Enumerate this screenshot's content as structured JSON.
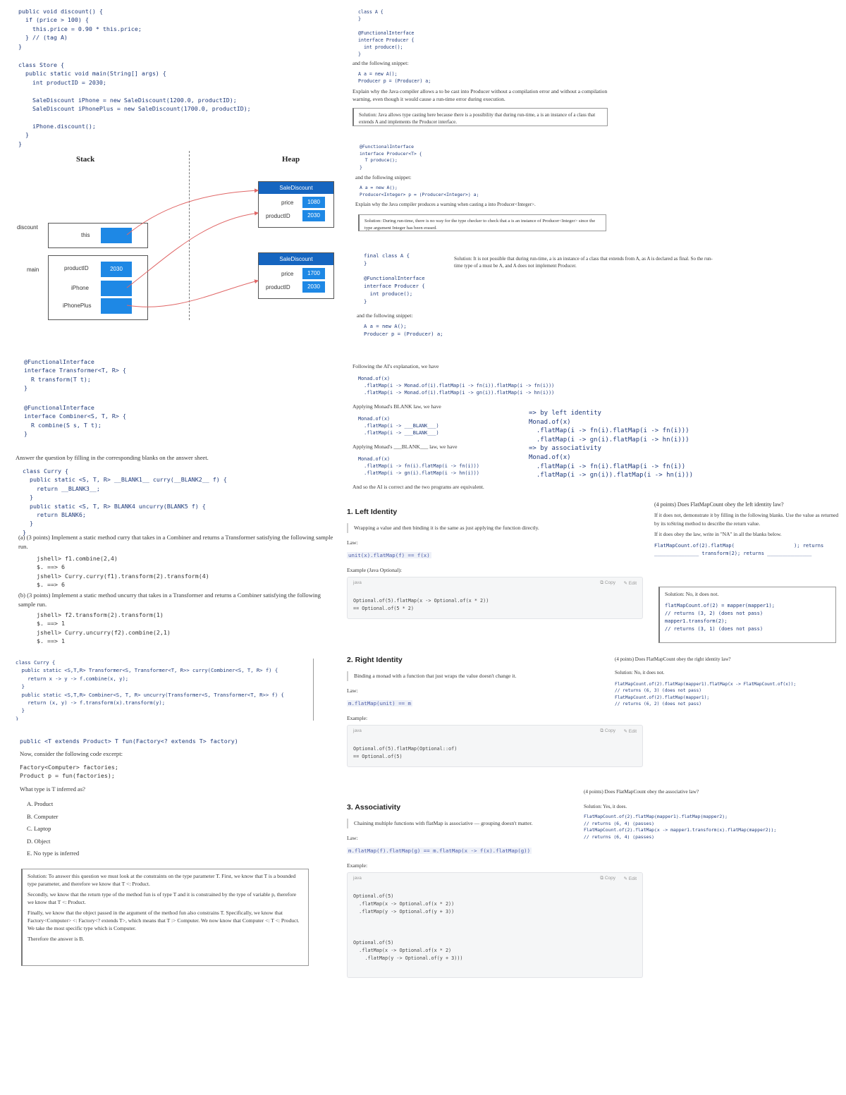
{
  "c1_discount": "public void discount() {\n  if (price > 100) {\n    this.price = 0.90 * this.price;\n  } // (tag A)\n}",
  "c1_main": "class Store {\n  public static void main(String[] args) {\n    int productID = 2030;\n\n    SaleDiscount iPhone = new SaleDiscount(1200.0, productID);\n    SaleDiscount iPhonePlus = new SaleDiscount(1700.0, productID);\n\n    iPhone.discount();\n  }\n}",
  "diagram": {
    "stack_label": "Stack",
    "heap_label": "Heap",
    "frame_discount_label": "discount",
    "frame_main_label": "main",
    "this_label": "this",
    "productID_label": "productID",
    "productID_value": "2030",
    "iphone_label": "iPhone",
    "iphoneplus_label": "iPhonePlus",
    "heap1": {
      "title": "SaleDiscount",
      "price_label": "price",
      "price_value": "1080",
      "pid_label": "productID",
      "pid_value": "2030"
    },
    "heap2": {
      "title": "SaleDiscount",
      "price_label": "price",
      "price_value": "1700",
      "pid_label": "productID",
      "pid_value": "2030"
    }
  },
  "c1_transformer": "@FunctionalInterface\ninterface Transformer<T, R> {\n  R transform(T t);\n}",
  "c1_combiner": "@FunctionalInterface\ninterface Combiner<S, T, R> {\n  R combine(S s, T t);\n}",
  "c1_answer_prompt": "Answer the question by filling in the corresponding blanks on the answer sheet.",
  "c1_curry_blank": "class Curry {\n  public static <S, T, R> __BLANK1__ curry(__BLANK2__ f) {\n    return __BLANK3__;\n  }\n  public static <S, T, R> BLANK4 uncurry(BLANK5 f) {\n    return BLANK6;\n  }\n}",
  "c1_q_a": "(a) (3 points) Implement a static method curry that takes in a Combiner and returns a Transformer satisfying the following sample run.",
  "c1_q_a_run": "jshell> f1.combine(2,4)\n$. ==> 6\njshell> Curry.curry(f1).transform(2).transform(4)\n$. ==> 6",
  "c1_q_b": "(b) (3 points) Implement a static method uncurry that takes in a Transformer and returns a Combiner satisfying the following sample run.",
  "c1_q_b_run": "jshell> f2.transform(2).transform(1)\n$. ==> 1\njshell> Curry.uncurry(f2).combine(2,1)\n$. ==> 1",
  "c1_curry_solution": "class Curry {\n  public static <S,T,R> Transformer<S, Transformer<T, R>> curry(Combiner<S, T, R> f) {\n    return x -> y -> f.combine(x, y);\n  }\n  public static <S,T,R> Combiner<S, T, R> uncurry(Transformer<S, Transformer<T, R>> f) {\n    return (x, y) -> f.transform(x).transform(y);\n  }\n}",
  "c1_fun_decl": "public <T extends Product> T fun(Factory<? extends T> factory)",
  "c1_fun_consider": "Now, consider the following code excerpt:",
  "c1_fun_code": "Factory<Computer> factories;\nProduct p = fun(factories);",
  "c1_fun_question": "What type is T inferred as?",
  "c1_options": [
    "A. Product",
    "B. Computer",
    "C. Laptop",
    "D. Object",
    "E. No type is inferred"
  ],
  "c1_sol_p1": "Solution: To answer this question we must look at the constraints on the type parameter T. First, we know that T is a bounded type parameter, and therefore we know that T <: Product.",
  "c1_sol_p2": "Secondly, we know that the return type of the method fun is of type T and it is constrained by the type of variable p, therefore we know that T <: Product.",
  "c1_sol_p3": "Finally, we know that the object passed in the argument of the method fun also constrains T. Specifically, we know that Factory<Computer> <: Factory<? extends T>, which means that T :> Computer. We now know that Computer <: T <: Product. We take the most specific type which is Computer.",
  "c1_sol_p4": "Therefore the answer is B.",
  "c2_classA": "class A {\n}\n\n@FunctionalInterface\ninterface Producer {\n  int produce();\n}",
  "c2_snippet_intro": "and the following snippet:",
  "c2_snippet": "A a = new A();\nProducer p = (Producer) a;",
  "c2_explain": "Explain why the Java compiler allows a to be cast into Producer without a compilation error and without a compilation warning, even though it would cause a run-time error during execution.",
  "c2_sol1": "Solution: Java allows type casting here because there is a possibility that during run-time, a is an instance of a class that extends A and implements the Producer interface.",
  "c2_generic": "@FunctionalInterface\ninterface Producer<T> {\n  T produce();\n}",
  "c2_snippet2": "A a = new A();\nProducer<Integer> p = (Producer<Integer>) a;",
  "c2_explain2": "Explain why the Java compiler produces a warning when casting a into Producer<Integer>.",
  "c2_sol2": "Solution: During run-time, there is no way for the type checker to check that a is an instance of Producer<Integer> since the type argument Integer has been erased.",
  "c2_final": "final class A {\n}\n\n@FunctionalInterface\ninterface Producer {\n  int produce();\n}",
  "c2_sol3": "Solution: It is not possible that during run-time, a is an instance of a class that extends from A, as A is declared as final. So the run-time type of a must be A, and A does not implement Producer.",
  "c2_snippet3": "A a = new A();\nProducer p = (Producer) a;",
  "c2_following": "Following the AI's explanation, we have",
  "c2_monad1": "Monad.of(x)\n  .flatMap(i -> Monad.of(i).flatMap(i -> fn(i)).flatMap(i -> fn(i)))\n  .flatMap(i -> Monad.of(i).flatMap(i -> gn(i)).flatMap(i -> hn(i)))",
  "c2_apply1": "Applying Monad's BLANK law, we have",
  "c2_monad2": "Monad.of(x)\n  .flatMap(i -> ___BLANK___)\n  .flatMap(i -> ___BLANK___)",
  "c2_apply2": "Applying Monad's ___BLANK___ law, we have",
  "c2_monad3": "Monad.of(x)\n  .flatMap(i -> fn(i).flatMap(i -> fn(i)))\n  .flatMap(i -> gn(i).flatMap(i -> hn(i)))",
  "c2_conclude": "And so the AI is correct and the two programs are equivalent.",
  "c2_right_derivation": "=> by left identity\nMonad.of(x)\n  .flatMap(i -> fn(i).flatMap(i -> fn(i)))\n  .flatMap(i -> gn(i).flatMap(i -> hn(i)))\n=> by associativity\nMonad.of(x)\n  .flatMap(i -> fn(i).flatMap(i -> fn(i))\n  .flatMap(i -> gn(i)).flatMap(i -> hn(i)))",
  "left": {
    "title": "1. Left Identity",
    "desc": "Wrapping a value and then binding it is the same as just applying the function directly.",
    "law_label": "Law:",
    "law": "unit(x).flatMap(f) == f(x)",
    "example_label": "Example (Java Optional):",
    "lang": "java",
    "copy": "Copy",
    "edit": "Edit",
    "code": "Optional.of(5).flatMap(x -> Optional.of(x * 2))\n== Optional.of(5 * 2)"
  },
  "right": {
    "title": "2. Right Identity",
    "desc": "Binding a monad with a function that just wraps the value doesn't change it.",
    "law_label": "Law:",
    "law": "m.flatMap(unit) == m",
    "example_label": "Example:",
    "lang": "java",
    "copy": "Copy",
    "edit": "Edit",
    "code": "Optional.of(5).flatMap(Optional::of)\n== Optional.of(5)"
  },
  "assoc": {
    "title": "3. Associativity",
    "desc": "Chaining multiple functions with flatMap is associative — grouping doesn't matter.",
    "law_label": "Law:",
    "law": "m.flatMap(f).flatMap(g) == m.flatMap(x -> f(x).flatMap(g))",
    "example_label": "Example:",
    "lang": "java",
    "copy": "Copy",
    "edit": "Edit",
    "code": "Optional.of(5)\n  .flatMap(x -> Optional.of(x * 2))\n  .flatMap(y -> Optional.of(y + 3))\n\n\n\nOptional.of(5)\n  .flatMap(x -> Optional.of(x * 2)\n    .flatMap(y -> Optional.of(y + 3)))"
  },
  "q4": {
    "q": "(4 points) Does FlatMapCount obey the left identity law?",
    "instr1": "If it does not, demonstrate it by filling in the following blanks. Use the value as returned by its toString method to describe the return value.",
    "instr2": "If it does obey the law, write in \"NA\" in all the blanks below.",
    "fill": "FlatMapCount.of(2).flatMap(                    ); returns\n_______________ transform(2); returns _______________",
    "sol": "Solution: No, it does not.",
    "sol_code": "flatMapCount.of(2) = mapper(mapper1);\n// returns (3, 2) (does not pass)\nmapper1.transform(2);\n// returns (3, 1) (does not pass)"
  },
  "q5": {
    "q": "(4 points) Does FlatMapCount obey the right identity law?",
    "sol": "Solution: No, it does not.",
    "code": "FlatMapCount.of(2).flatMap(mapper1).flatMap(x -> FlatMapCount.of(x));\n// returns (6, 3) (does not pass)\nFlatMapCount.of(2).flatMap(mapper1);\n// returns (6, 2) (does not pass)"
  },
  "q6": {
    "q": "(4 points) Does FlatMapCount obey the associative law?",
    "sol": "Solution: Yes, it does.",
    "code": "FlatMapCount.of(2).flatMap(mapper1).flatMap(mapper2);\n// returns (6, 4) (passes)\nFlatMapCount.of(2).flatMap(x -> mapper1.transform(x).flatMap(mapper2));\n// returns (6, 4) (passes)"
  }
}
